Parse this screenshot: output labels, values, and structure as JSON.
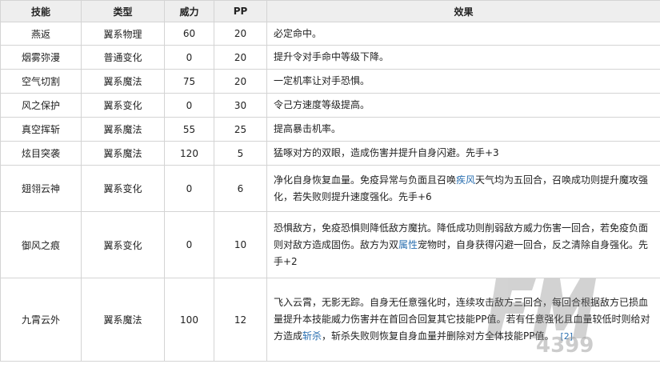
{
  "headers": [
    "技能",
    "类型",
    "威力",
    "PP",
    "效果"
  ],
  "rows": [
    {
      "name": "燕返",
      "type": "翼系物理",
      "power": "60",
      "pp": "20",
      "effect": "必定命中。"
    },
    {
      "name": "烟雾弥漫",
      "type": "普通变化",
      "power": "0",
      "pp": "20",
      "effect": "提升令对手命中等级下降。"
    },
    {
      "name": "空气切割",
      "type": "翼系魔法",
      "power": "75",
      "pp": "20",
      "effect": "一定机率让对手恐惧。"
    },
    {
      "name": "风之保护",
      "type": "翼系变化",
      "power": "0",
      "pp": "30",
      "effect": "令己方速度等级提高。"
    },
    {
      "name": "真空挥斩",
      "type": "翼系魔法",
      "power": "55",
      "pp": "25",
      "effect": "提高暴击机率。"
    },
    {
      "name": "炫目突袭",
      "type": "翼系魔法",
      "power": "120",
      "pp": "5",
      "effect": "猛啄对方的双眼，造成伤害并提升自身闪避。先手+3"
    },
    {
      "name": "翅翎云神",
      "type": "翼系变化",
      "power": "0",
      "pp": "6",
      "effect_parts": [
        "净化自身恢复血量。免疫异常与负面且召唤",
        "疾风",
        "天气均为五回合，召唤成功则提升魔攻强化，若失败则提升速度强化。先手+6"
      ]
    },
    {
      "name": "御风之痕",
      "type": "翼系变化",
      "power": "0",
      "pp": "10",
      "effect_parts": [
        "恐惧敌方，免疫恐惧则降低敌方魔抗。降低成功则削弱敌方威力伤害一回合，若免疫负面则对敌方造成固伤。敌方为双",
        "属性",
        "宠物时，自身获得闪避一回合，反之清除自身强化。先手+2"
      ]
    },
    {
      "name": "九霄云外",
      "type": "翼系魔法",
      "power": "100",
      "pp": "12",
      "effect_parts": [
        "飞入云霄，无影无踪。自身无任意强化时，连续攻击敌方三回合，每回合根据敌方已损血量提升本技能威力伤害并在首回合回复其它技能PP值。若有任意强化且血量较低时则给对方造成",
        "斩杀",
        "，斩杀失败则恢复自身血量并删除对方全体技能PP值。"
      ],
      "ref": "[2]"
    }
  ],
  "watermark": {
    "text": "4399",
    "color": "#9a9a9a"
  }
}
